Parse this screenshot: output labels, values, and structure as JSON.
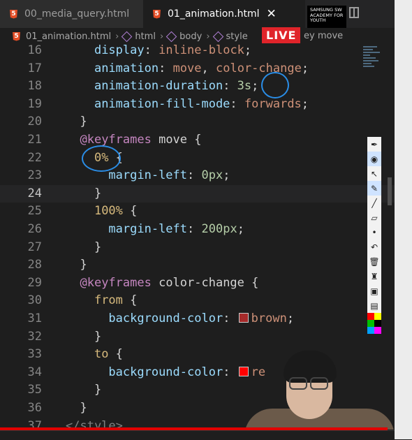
{
  "tabs": [
    {
      "label": "00_media_query.html",
      "active": false
    },
    {
      "label": "01_animation.html",
      "active": true
    }
  ],
  "tab_icon_text": "5",
  "close_glyph": "✕",
  "logo_text": "SAMSUNG SW ACADEMY FOR YOUTH",
  "breadcrumb": [
    "01_animation.html",
    "html",
    "body",
    "style"
  ],
  "breadcrumb_tail": "ey   move",
  "live_badge": "LIVE",
  "code_lines": [
    {
      "n": "16",
      "indent": "    ",
      "tokens": [
        {
          "t": "display",
          "c": "prop"
        },
        {
          "t": ": ",
          "c": "punc"
        },
        {
          "t": "inline-block",
          "c": "val"
        },
        {
          "t": ";",
          "c": "punc"
        }
      ]
    },
    {
      "n": "17",
      "indent": "    ",
      "tokens": [
        {
          "t": "animation",
          "c": "prop"
        },
        {
          "t": ": ",
          "c": "punc"
        },
        {
          "t": "move",
          "c": "val"
        },
        {
          "t": ", ",
          "c": "punc"
        },
        {
          "t": "color-change",
          "c": "val"
        },
        {
          "t": ";",
          "c": "punc"
        }
      ]
    },
    {
      "n": "18",
      "indent": "    ",
      "tokens": [
        {
          "t": "animation-duration",
          "c": "prop"
        },
        {
          "t": ": ",
          "c": "punc"
        },
        {
          "t": "3s",
          "c": "num"
        },
        {
          "t": ";",
          "c": "punc"
        }
      ]
    },
    {
      "n": "19",
      "indent": "    ",
      "tokens": [
        {
          "t": "animation-fill-mode",
          "c": "prop"
        },
        {
          "t": ": ",
          "c": "punc"
        },
        {
          "t": "forwards",
          "c": "val"
        },
        {
          "t": ";",
          "c": "punc"
        }
      ]
    },
    {
      "n": "20",
      "indent": "  ",
      "tokens": [
        {
          "t": "}",
          "c": "punc"
        }
      ]
    },
    {
      "n": "21",
      "indent": "  ",
      "tokens": [
        {
          "t": "@keyframes",
          "c": "at"
        },
        {
          "t": " move ",
          "c": "punc"
        },
        {
          "t": "{",
          "c": "punc"
        }
      ]
    },
    {
      "n": "22",
      "indent": "    ",
      "tokens": [
        {
          "t": "0%",
          "c": "sel"
        },
        {
          "t": " {",
          "c": "punc"
        }
      ]
    },
    {
      "n": "23",
      "indent": "      ",
      "tokens": [
        {
          "t": "margin-left",
          "c": "prop"
        },
        {
          "t": ": ",
          "c": "punc"
        },
        {
          "t": "0px",
          "c": "num"
        },
        {
          "t": ";",
          "c": "punc"
        }
      ]
    },
    {
      "n": "24",
      "indent": "    ",
      "current": true,
      "tokens": [
        {
          "t": "}",
          "c": "punc"
        }
      ]
    },
    {
      "n": "25",
      "indent": "    ",
      "tokens": [
        {
          "t": "100%",
          "c": "sel"
        },
        {
          "t": " {",
          "c": "punc"
        }
      ]
    },
    {
      "n": "26",
      "indent": "      ",
      "tokens": [
        {
          "t": "margin-left",
          "c": "prop"
        },
        {
          "t": ": ",
          "c": "punc"
        },
        {
          "t": "200px",
          "c": "num"
        },
        {
          "t": ";",
          "c": "punc"
        }
      ]
    },
    {
      "n": "27",
      "indent": "    ",
      "tokens": [
        {
          "t": "}",
          "c": "punc"
        }
      ]
    },
    {
      "n": "28",
      "indent": "  ",
      "tokens": [
        {
          "t": "}",
          "c": "punc"
        }
      ]
    },
    {
      "n": "29",
      "indent": "  ",
      "tokens": [
        {
          "t": "@keyframes",
          "c": "at"
        },
        {
          "t": " color-change ",
          "c": "punc"
        },
        {
          "t": "{",
          "c": "punc"
        }
      ]
    },
    {
      "n": "30",
      "indent": "    ",
      "tokens": [
        {
          "t": "from",
          "c": "sel"
        },
        {
          "t": " {",
          "c": "punc"
        }
      ]
    },
    {
      "n": "31",
      "indent": "      ",
      "tokens": [
        {
          "t": "background-color",
          "c": "prop"
        },
        {
          "t": ": ",
          "c": "punc"
        },
        {
          "t": "",
          "c": "swatch",
          "color": "#a52a2a"
        },
        {
          "t": "brown",
          "c": "val"
        },
        {
          "t": ";",
          "c": "punc"
        }
      ]
    },
    {
      "n": "32",
      "indent": "    ",
      "tokens": [
        {
          "t": "}",
          "c": "punc"
        }
      ]
    },
    {
      "n": "33",
      "indent": "    ",
      "tokens": [
        {
          "t": "to",
          "c": "sel"
        },
        {
          "t": " {",
          "c": "punc"
        }
      ]
    },
    {
      "n": "34",
      "indent": "      ",
      "tokens": [
        {
          "t": "background-color",
          "c": "prop"
        },
        {
          "t": ": ",
          "c": "punc"
        },
        {
          "t": "",
          "c": "swatch",
          "color": "#ff0000"
        },
        {
          "t": "re",
          "c": "val"
        }
      ]
    },
    {
      "n": "35",
      "indent": "    ",
      "tokens": [
        {
          "t": "}",
          "c": "punc"
        }
      ]
    },
    {
      "n": "36",
      "indent": "  ",
      "tokens": [
        {
          "t": "}",
          "c": "punc"
        }
      ]
    },
    {
      "n": "37",
      "indent": "",
      "tokens": [
        {
          "t": "</style>",
          "c": "tag"
        }
      ]
    }
  ],
  "pen_tools": [
    "pen-nib-icon",
    "eye-icon",
    "cursor-icon",
    "highlighter-icon",
    "pencil-icon",
    "eraser-icon",
    "dot-icon",
    "undo-icon",
    "trash-icon",
    "stamp-icon",
    "camera-icon",
    "clipboard-icon"
  ],
  "palette": [
    "#ff0000",
    "#ffff00",
    "#00c000",
    "#000000",
    "#00a0ff",
    "#ff00ff"
  ],
  "colors": {
    "live": "#e0242a",
    "progress": "#e00000",
    "annotation": "#2a8de6"
  }
}
